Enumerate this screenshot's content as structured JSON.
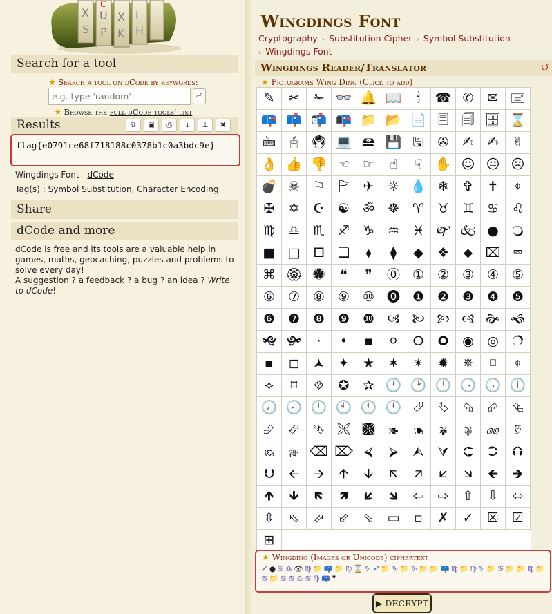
{
  "sidebar": {
    "search_title": "Search for a tool",
    "search_label": "Search a tool on dCode by keywords:",
    "search_placeholder": "e.g. type 'random'",
    "search_button_icon": "enter-icon",
    "browse_prefix": "Browse the ",
    "browse_link": "full dCode tools' list",
    "results_title": "Results",
    "result_tools": [
      "copy-icon",
      "screenshot-icon",
      "print-icon",
      "download-icon",
      "pin-icon",
      "close-icon"
    ],
    "result_text": "flag{e0791ce68f718188c0378b1c0a3bdc9e}",
    "tool_name_prefix": "Wingdings Font - ",
    "tool_name_link": "dCode",
    "tags": "Tag(s) : Symbol Substitution, Character Encoding",
    "share_title": "Share",
    "more_title": "dCode and more",
    "about_text": "dCode is free and its tools are a valuable help in games, maths, geocaching, puzzles and problems to solve every day!",
    "suggestion_text": "A suggestion ? a feedback ? a bug ? an idea ? ",
    "suggestion_link": "Write to dCode",
    "suggestion_end": "!"
  },
  "main": {
    "title": "Wingdings Font",
    "breadcrumbs": [
      "Cryptography",
      "Substitution Cipher",
      "Symbol Substitution",
      "Wingdings Font"
    ],
    "section_title": "Wingdings Reader/Translator",
    "reset_icon": "reset-icon",
    "picto_label": "Pictograms Wing Ding (Click to add)",
    "symbols": [
      "✎",
      "✂",
      "✁",
      "👓",
      "🔔",
      "📖",
      "🕯",
      "☎",
      "✆",
      "✉",
      "🖃",
      "📪",
      "📫",
      "📬",
      "📭",
      "📁",
      "📂",
      "📄",
      "🗏",
      "🗐",
      "🗄",
      "⌛",
      "🖮",
      "🖰",
      "🖲",
      "💻",
      "🖴",
      "💾",
      "🖫",
      "✇",
      "✍",
      "✍",
      "✌",
      "👌",
      "👍",
      "👎",
      "☜",
      "☞",
      "☝",
      "☟",
      "✋",
      "☺",
      "😐",
      "☹",
      "💣",
      "☠",
      "⚐",
      "🏱",
      "✈",
      "☼",
      "💧",
      "❄",
      "✞",
      "✝",
      "⌖",
      "✠",
      "✡",
      "☪",
      "☯",
      "ॐ",
      "☸",
      "♈",
      "♉",
      "♊",
      "♋",
      "♌",
      "♍",
      "♎",
      "♏",
      "♐",
      "♑",
      "♒",
      "♓",
      "🙰",
      "🙵",
      "●",
      "🔾",
      "■",
      "□",
      "🞐",
      "❑",
      "⬧",
      "⧫",
      "◆",
      "❖",
      "⬥",
      "⌧",
      "⮹",
      "⌘",
      "🏵",
      "🏶",
      "❝",
      "❞",
      "⓪",
      "①",
      "②",
      "③",
      "④",
      "⑤",
      "⑥",
      "⑦",
      "⑧",
      "⑨",
      "⑩",
      "⓿",
      "❶",
      "❷",
      "❸",
      "❹",
      "❺",
      "❻",
      "❼",
      "❽",
      "❾",
      "❿",
      "🙢",
      "🙠",
      "🙡",
      "🙣",
      "🙞",
      "🙜",
      "🙝",
      "🙟",
      "·",
      "•",
      "▪",
      "⚪",
      "🞆",
      "🞈",
      "◉",
      "◎",
      "🔿",
      "▪",
      "◻",
      "🟂",
      "✦",
      "★",
      "✶",
      "✴",
      "✹",
      "✵",
      "⯐",
      "⌖",
      "⟡",
      "⌑",
      "⯑",
      "✪",
      "✰",
      "🕐",
      "🕑",
      "🕒",
      "🕓",
      "🕔",
      "🕕",
      "🕖",
      "🕗",
      "🕘",
      "🕙",
      "🕚",
      "🕛",
      "⮰",
      "⮱",
      "⮲",
      "⮳",
      "⮴",
      "⮵",
      "⮶",
      "⮷",
      "🙪",
      "🙫",
      "🙕",
      "🙔",
      "🙗",
      "🙖",
      "🙐",
      "🙑",
      "🙒",
      "🙓",
      "⌫",
      "⌦",
      "⮘",
      "⮚",
      "⮙",
      "⮛",
      "⮈",
      "⮊",
      "⮉",
      "⮋",
      "🡨",
      "🡪",
      "🡩",
      "🡫",
      "🡬",
      "🡭",
      "🡯",
      "🡮",
      "🡸",
      "🡺",
      "🡹",
      "🡻",
      "🡼",
      "🡽",
      "🡿",
      "🡾",
      "⇦",
      "⇨",
      "⇧",
      "⇩",
      "⬄",
      "⇳",
      "⬁",
      "⬀",
      "⬃",
      "⬂",
      "▭",
      "▫",
      "✗",
      "✓",
      "☒",
      "☑",
      "⊞"
    ],
    "cipher_label": "Wingding (Images or Unicode) ciphertext",
    "cipher_symbols": [
      "♐",
      "●",
      "♋",
      "♎",
      "👁",
      "♍",
      "📁",
      "📪",
      "📁",
      "♍",
      "⌛",
      "♑",
      "♐",
      "📁",
      "♑",
      "📁",
      "♑",
      "📁",
      "📁",
      "📪",
      "♍",
      "📁",
      "♍",
      "♑",
      "📁",
      "♋",
      "📁",
      "📁",
      "♍",
      "📁",
      "♋",
      "📁",
      "♋",
      "♋",
      "♎",
      "♋",
      "♍",
      "📪",
      "❞"
    ],
    "decrypt_label": "▶ DECRYPT"
  }
}
